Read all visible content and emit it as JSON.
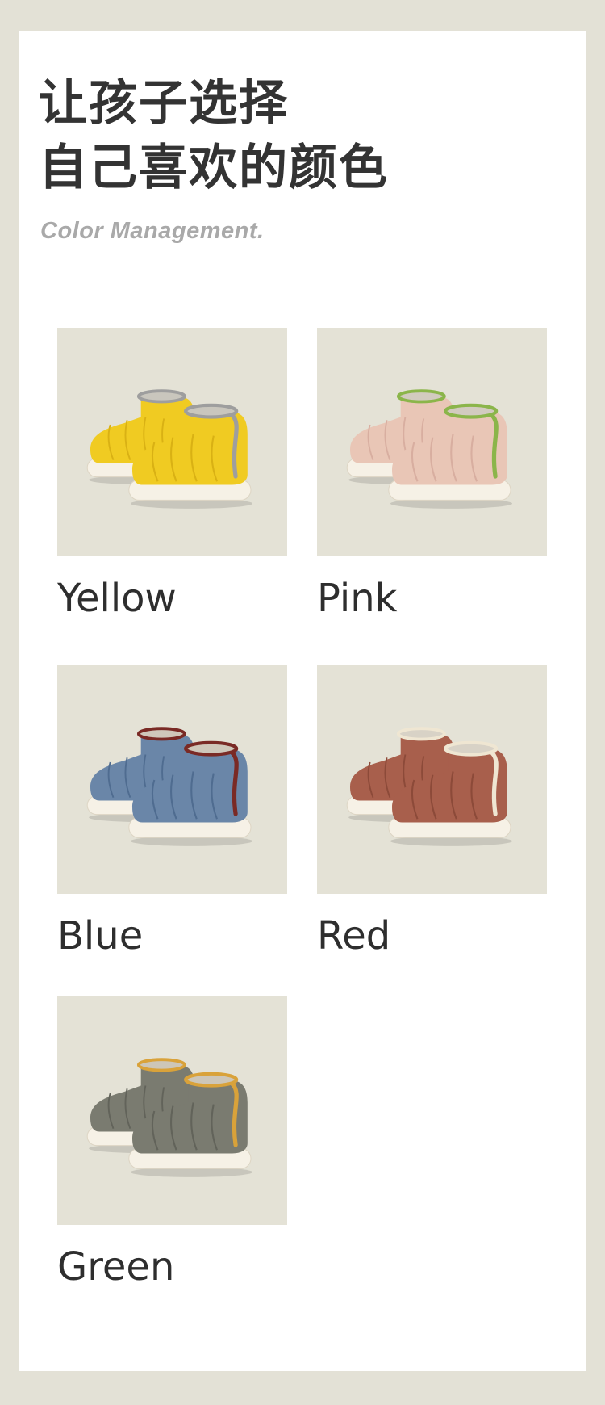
{
  "heading": {
    "line1": "让孩子选择",
    "line2": "自己喜欢的颜色"
  },
  "subtitle": "Color Management.",
  "products": [
    {
      "label": "Yellow",
      "body_color": "#f0cb22",
      "body_shade": "#d9b114",
      "trim_color": "#9e9e9e",
      "fur_color": "#c9c6bd"
    },
    {
      "label": "Pink",
      "body_color": "#e9c6b6",
      "body_shade": "#d8aea0",
      "trim_color": "#8bb54a",
      "fur_color": "#d2cbbf"
    },
    {
      "label": "Blue",
      "body_color": "#6a86a8",
      "body_shade": "#4f6c90",
      "trim_color": "#7a2a25",
      "fur_color": "#cfc7ba"
    },
    {
      "label": "Red",
      "body_color": "#a85f4c",
      "body_shade": "#8c4a39",
      "trim_color": "#efe6d2",
      "fur_color": "#d8d2c6"
    },
    {
      "label": "Green",
      "body_color": "#7a7b70",
      "body_shade": "#62635a",
      "trim_color": "#d9a23a",
      "fur_color": "#cdc6b8"
    }
  ]
}
